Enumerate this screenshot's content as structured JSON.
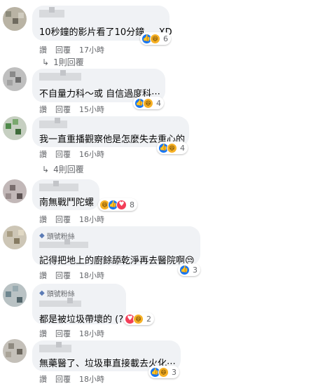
{
  "comments": [
    {
      "text": "10秒鐘的影片看了10分鐘.....XD",
      "reactions": [
        "like",
        "haha"
      ],
      "count": "6",
      "time": "17小時",
      "fan": false
    },
    {
      "text": "不自量力科～或 自信過度科⋯",
      "reactions": [
        "like",
        "haha"
      ],
      "count": "4",
      "time": "15小時",
      "fan": false
    },
    {
      "text": "我一直重播觀察他是怎麼失去重心的",
      "reactions": [
        "like",
        "haha"
      ],
      "count": "4",
      "time": "16小時",
      "fan": false
    },
    {
      "text": "南無戰鬥陀螺",
      "reactions": [
        "haha",
        "like",
        "love"
      ],
      "count": "8",
      "time": "18小時",
      "fan": false
    },
    {
      "text": "記得把地上的廚餘舔乾淨再去醫院啊😒",
      "reactions": [
        "like"
      ],
      "count": "3",
      "time": "18小時",
      "fan": true
    },
    {
      "text": "都是被垃圾帶壞的 (?",
      "reactions": [
        "love",
        "haha"
      ],
      "count": "2",
      "time": "18小時",
      "fan": true
    },
    {
      "text": "無藥醫了、垃圾車直接載去火化⋯",
      "reactions": [
        "like",
        "haha"
      ],
      "count": "3",
      "time": "18小時",
      "fan": false
    }
  ],
  "actions": {
    "read": "讚",
    "reply": "回覆"
  },
  "fan_badge": "頭號粉絲",
  "replies": [
    {
      "label": "1則回覆"
    },
    {
      "label": "4則回覆"
    }
  ],
  "colors": {
    "bubble": "#f0f2f5",
    "like": "#1877f2",
    "haha": "#f7b125",
    "love": "#f33e58",
    "meta": "#65676b"
  }
}
